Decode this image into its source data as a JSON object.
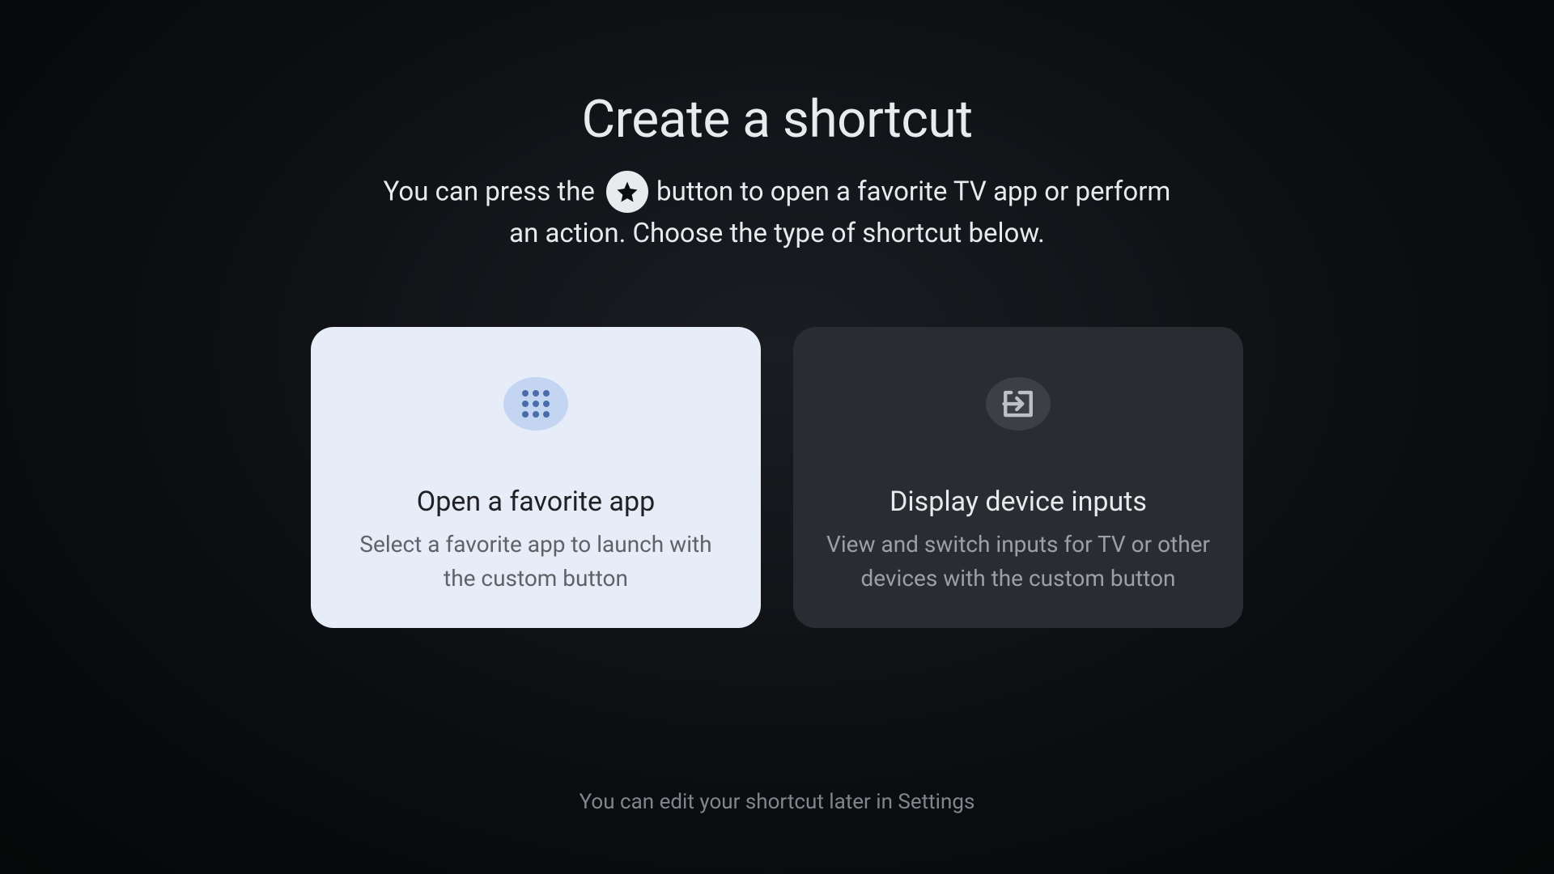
{
  "header": {
    "title": "Create a shortcut",
    "subtitle_before": "You can press the ",
    "subtitle_after": " button to open a favorite TV app or perform an action. Choose the type of shortcut below."
  },
  "cards": {
    "favorite_app": {
      "title": "Open a favorite app",
      "description": "Select a favorite app to launch with the custom button"
    },
    "device_inputs": {
      "title": "Display device inputs",
      "description": "View and switch inputs for TV or other devices with the custom button"
    }
  },
  "footer": {
    "note": "You can edit your shortcut later in Settings"
  }
}
